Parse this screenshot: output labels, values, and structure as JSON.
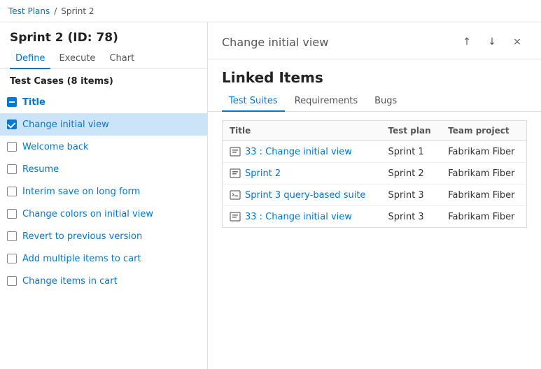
{
  "breadcrumb": {
    "parent": "Test Plans",
    "separator": "/",
    "current": "Sprint 2"
  },
  "sprint": {
    "title": "Sprint 2 (ID: 78)"
  },
  "left_tabs": [
    {
      "id": "define",
      "label": "Define",
      "active": true
    },
    {
      "id": "execute",
      "label": "Execute",
      "active": false
    },
    {
      "id": "chart",
      "label": "Chart",
      "active": false
    }
  ],
  "test_cases_header": "Test Cases (8 items)",
  "test_cases": [
    {
      "id": "title-row",
      "label": "Title",
      "type": "header",
      "checked": "indeterminate"
    },
    {
      "id": "change-initial-view",
      "label": "Change initial view",
      "type": "item",
      "checked": true,
      "selected": true
    },
    {
      "id": "welcome-back",
      "label": "Welcome back",
      "type": "item",
      "checked": false,
      "selected": false
    },
    {
      "id": "resume",
      "label": "Resume",
      "type": "item",
      "checked": false,
      "selected": false
    },
    {
      "id": "interim-save",
      "label": "Interim save on long form",
      "type": "item",
      "checked": false,
      "selected": false
    },
    {
      "id": "change-colors",
      "label": "Change colors on initial view",
      "type": "item",
      "checked": false,
      "selected": false
    },
    {
      "id": "revert",
      "label": "Revert to previous version",
      "type": "item",
      "checked": false,
      "selected": false
    },
    {
      "id": "add-multiple",
      "label": "Add multiple items to cart",
      "type": "item",
      "checked": false,
      "selected": false
    },
    {
      "id": "change-items",
      "label": "Change items in cart",
      "type": "item",
      "checked": false,
      "selected": false
    }
  ],
  "right_panel": {
    "header_title": "Change initial view",
    "linked_items_title": "Linked Items",
    "tabs": [
      {
        "id": "test-suites",
        "label": "Test Suites",
        "active": true
      },
      {
        "id": "requirements",
        "label": "Requirements",
        "active": false
      },
      {
        "id": "bugs",
        "label": "Bugs",
        "active": false
      }
    ],
    "table": {
      "columns": [
        "Title",
        "Test plan",
        "Team project"
      ],
      "rows": [
        {
          "title": "33 : Change initial view",
          "test_plan": "Sprint 1",
          "team_project": "Fabrikam Fiber",
          "icon": "suite"
        },
        {
          "title": "Sprint 2",
          "test_plan": "Sprint 2",
          "team_project": "Fabrikam Fiber",
          "icon": "suite"
        },
        {
          "title": "Sprint 3 query-based suite",
          "test_plan": "Sprint 3",
          "team_project": "Fabrikam Fiber",
          "icon": "query-suite"
        },
        {
          "title": "33 : Change initial view",
          "test_plan": "Sprint 3",
          "team_project": "Fabrikam Fiber",
          "icon": "suite"
        }
      ]
    }
  },
  "icons": {
    "arrow_up": "↑",
    "arrow_down": "↓",
    "close": "×"
  }
}
